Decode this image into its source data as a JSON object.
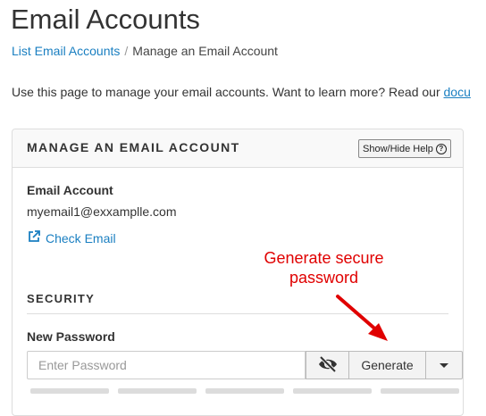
{
  "page": {
    "title": "Email Accounts"
  },
  "breadcrumb": {
    "link": "List Email Accounts",
    "separator": "/",
    "current": "Manage an Email Account"
  },
  "intro": {
    "text": "Use this page to manage your email accounts. Want to learn more? Read our ",
    "link_text": "docu"
  },
  "panel": {
    "title": "MANAGE AN EMAIL ACCOUNT",
    "help_button": "Show/Hide Help",
    "help_icon": "question-circle-icon"
  },
  "account": {
    "label": "Email Account",
    "value": "myemail1@exxamplle.com",
    "check_email": "Check Email",
    "check_email_icon": "external-link-icon"
  },
  "security": {
    "title": "SECURITY",
    "new_password_label": "New Password",
    "password_placeholder": "Enter Password",
    "eye_icon": "eye-slash-icon",
    "generate_label": "Generate",
    "caret_icon": "caret-down-icon"
  },
  "annotation": {
    "line1": "Generate secure",
    "line2": "password",
    "color": "#e00000"
  },
  "colors": {
    "link": "#1a7fc1",
    "text": "#333333"
  }
}
